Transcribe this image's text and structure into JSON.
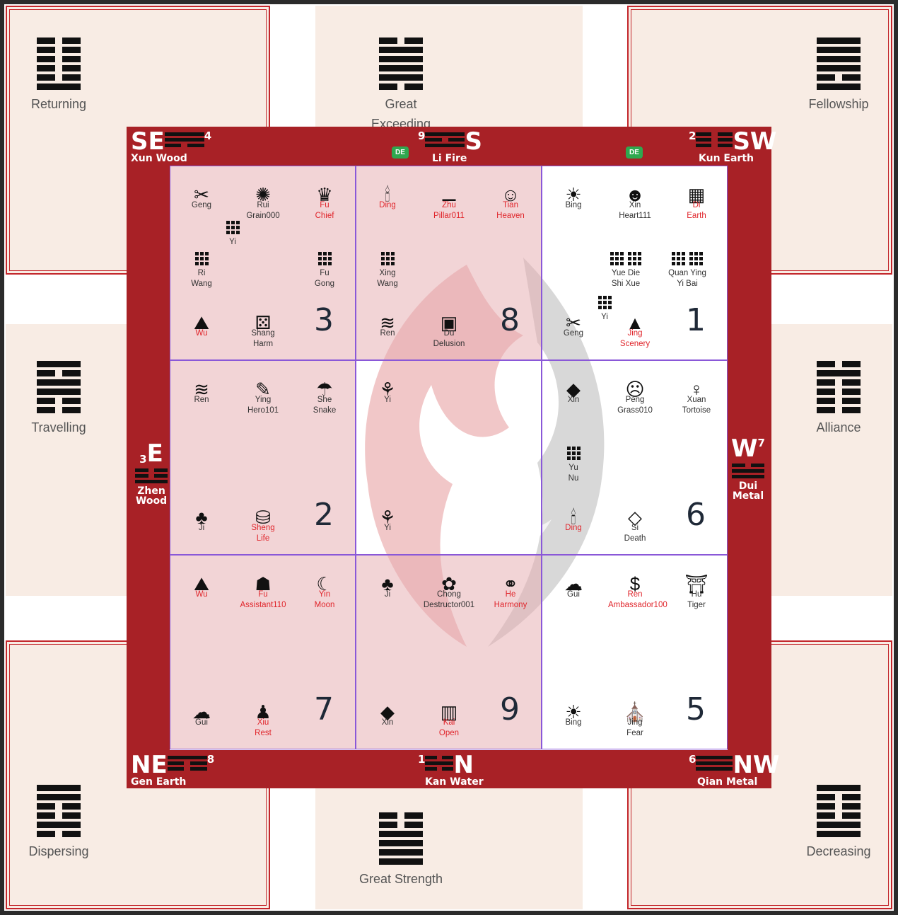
{
  "outer_hexagrams": [
    {
      "id": "nw",
      "label": "Returning",
      "lines": [
        0,
        0,
        0,
        0,
        0,
        1
      ]
    },
    {
      "id": "n",
      "label": "Great Exceeding",
      "lines": [
        0,
        1,
        1,
        1,
        1,
        0
      ]
    },
    {
      "id": "ne",
      "label": "Fellowship",
      "lines": [
        1,
        1,
        1,
        1,
        0,
        1
      ]
    },
    {
      "id": "w",
      "label": "Travelling",
      "lines": [
        1,
        0,
        1,
        1,
        0,
        0
      ]
    },
    {
      "id": "e",
      "label": "Alliance",
      "lines": [
        0,
        1,
        0,
        0,
        0,
        0
      ]
    },
    {
      "id": "sw",
      "label": "Dispersing",
      "lines": [
        1,
        1,
        0,
        0,
        1,
        0
      ]
    },
    {
      "id": "s",
      "label": "Great Strength",
      "lines": [
        0,
        0,
        1,
        1,
        1,
        1
      ]
    },
    {
      "id": "se",
      "label": "Decreasing",
      "lines": [
        1,
        0,
        0,
        0,
        1,
        1
      ]
    }
  ],
  "board": {
    "corners": {
      "se": {
        "dir": "SE",
        "name": "Xun Wood",
        "num": "4"
      },
      "s": {
        "dir": "S",
        "name": "Li Fire",
        "num": "9"
      },
      "sw": {
        "dir": "SW",
        "name": "Kun Earth",
        "num": "2"
      },
      "e": {
        "dir": "E",
        "name1": "Zhen",
        "name2": "Wood",
        "num": "3"
      },
      "w": {
        "dir": "W",
        "name1": "Dui",
        "name2": "Metal",
        "num": "7"
      },
      "ne": {
        "dir": "NE",
        "name": "Gen Earth",
        "num": "8"
      },
      "n": {
        "dir": "N",
        "name": "Kan Water",
        "num": "1"
      },
      "nw": {
        "dir": "NW",
        "name": "Qian Metal",
        "num": "6"
      }
    },
    "badges": [
      "DE",
      "DE"
    ],
    "cells": [
      {
        "num": "3",
        "items": [
          {
            "icon": "✂",
            "l1": "Geng",
            "l2": "",
            "red": false
          },
          {
            "icon": "✺",
            "l1": "Rui",
            "l2": "Grain000",
            "red": false
          },
          {
            "icon": "♛",
            "l1": "Fu",
            "l2": "Chief",
            "red": true
          },
          {
            "icon": "dots",
            "l1": "Yi",
            "l2": "",
            "red": false
          },
          {
            "icon": "dots",
            "l1": "Ri",
            "l2": "Wang",
            "red": false
          },
          {
            "icon": "dots",
            "l1": "Fu",
            "l2": "Gong",
            "red": false
          },
          {
            "icon": "⛰",
            "l1": "Wu",
            "l2": "",
            "red": true
          },
          {
            "icon": "⚄",
            "l1": "Shang",
            "l2": "Harm",
            "red": false
          }
        ]
      },
      {
        "num": "8",
        "items": [
          {
            "icon": "🕯",
            "l1": "Ding",
            "l2": "",
            "red": true
          },
          {
            "icon": "⚊",
            "l1": "Zhu",
            "l2": "Pillar011",
            "red": true
          },
          {
            "icon": "☺",
            "l1": "Tian",
            "l2": "Heaven",
            "red": true
          },
          {
            "icon": "dots",
            "l1": "Xing",
            "l2": "Wang",
            "red": false
          },
          {
            "icon": "≋",
            "l1": "Ren",
            "l2": "",
            "red": false
          },
          {
            "icon": "▣",
            "l1": "Du",
            "l2": "Delusion",
            "red": false
          }
        ]
      },
      {
        "num": "1",
        "items": [
          {
            "icon": "☀",
            "l1": "Bing",
            "l2": "",
            "red": false
          },
          {
            "icon": "☻",
            "l1": "Xin",
            "l2": "Heart111",
            "red": false
          },
          {
            "icon": "▦",
            "l1": "Di",
            "l2": "Earth",
            "red": true
          },
          {
            "icon": "dots2",
            "l1": "Yue Die",
            "l2": "Shi Xue",
            "red": false
          },
          {
            "icon": "dots2",
            "l1": "Quan Ying",
            "l2": "Yi Bai",
            "red": false
          },
          {
            "icon": "dots",
            "l1": "Yi",
            "l2": "",
            "red": false
          },
          {
            "icon": "✂",
            "l1": "Geng",
            "l2": "",
            "red": false
          },
          {
            "icon": "▲",
            "l1": "Jing",
            "l2": "Scenery",
            "red": true
          }
        ]
      },
      {
        "num": "2",
        "items": [
          {
            "icon": "≋",
            "l1": "Ren",
            "l2": "",
            "red": false
          },
          {
            "icon": "✎",
            "l1": "Ying",
            "l2": "Hero101",
            "red": false
          },
          {
            "icon": "☂",
            "l1": "She",
            "l2": "Snake",
            "red": false
          },
          {
            "icon": "♣",
            "l1": "Ji",
            "l2": "",
            "red": false
          },
          {
            "icon": "⛁",
            "l1": "Sheng",
            "l2": "Life",
            "red": true
          }
        ]
      },
      {
        "num": "",
        "items": [
          {
            "icon": "⚘",
            "l1": "Yi",
            "l2": "",
            "red": false
          },
          {
            "icon": "⚘",
            "l1": "Yi",
            "l2": "",
            "red": false
          }
        ]
      },
      {
        "num": "6",
        "items": [
          {
            "icon": "◆",
            "l1": "Xin",
            "l2": "",
            "red": false
          },
          {
            "icon": "☹",
            "l1": "Peng",
            "l2": "Grass010",
            "red": false
          },
          {
            "icon": "♀",
            "l1": "Xuan",
            "l2": "Tortoise",
            "red": false
          },
          {
            "icon": "dots",
            "l1": "Yu",
            "l2": "Nu",
            "red": false
          },
          {
            "icon": "🕯",
            "l1": "Ding",
            "l2": "",
            "red": true
          },
          {
            "icon": "◇",
            "l1": "Si",
            "l2": "Death",
            "red": false
          }
        ]
      },
      {
        "num": "7",
        "items": [
          {
            "icon": "⛰",
            "l1": "Wu",
            "l2": "",
            "red": true
          },
          {
            "icon": "☗",
            "l1": "Fu",
            "l2": "Assistant110",
            "red": true
          },
          {
            "icon": "☾",
            "l1": "Yin",
            "l2": "Moon",
            "red": true
          },
          {
            "icon": "☁",
            "l1": "Gui",
            "l2": "",
            "red": false
          },
          {
            "icon": "♟",
            "l1": "Xiu",
            "l2": "Rest",
            "red": true
          }
        ]
      },
      {
        "num": "9",
        "items": [
          {
            "icon": "♣",
            "l1": "Ji",
            "l2": "",
            "red": false
          },
          {
            "icon": "✿",
            "l1": "Chong",
            "l2": "Destructor001",
            "red": false
          },
          {
            "icon": "⚭",
            "l1": "He",
            "l2": "Harmony",
            "red": true
          },
          {
            "icon": "◆",
            "l1": "Xin",
            "l2": "",
            "red": false
          },
          {
            "icon": "▥",
            "l1": "Kai",
            "l2": "Open",
            "red": true
          }
        ]
      },
      {
        "num": "5",
        "items": [
          {
            "icon": "☁",
            "l1": "Gui",
            "l2": "",
            "red": false
          },
          {
            "icon": "$",
            "l1": "Ren",
            "l2": "Ambassador100",
            "red": true
          },
          {
            "icon": "⛩",
            "l1": "Hu",
            "l2": "Tiger",
            "red": false
          },
          {
            "icon": "☀",
            "l1": "Bing",
            "l2": "",
            "red": false
          },
          {
            "icon": "⛪",
            "l1": "Jing",
            "l2": "Fear",
            "red": false
          }
        ]
      }
    ]
  }
}
